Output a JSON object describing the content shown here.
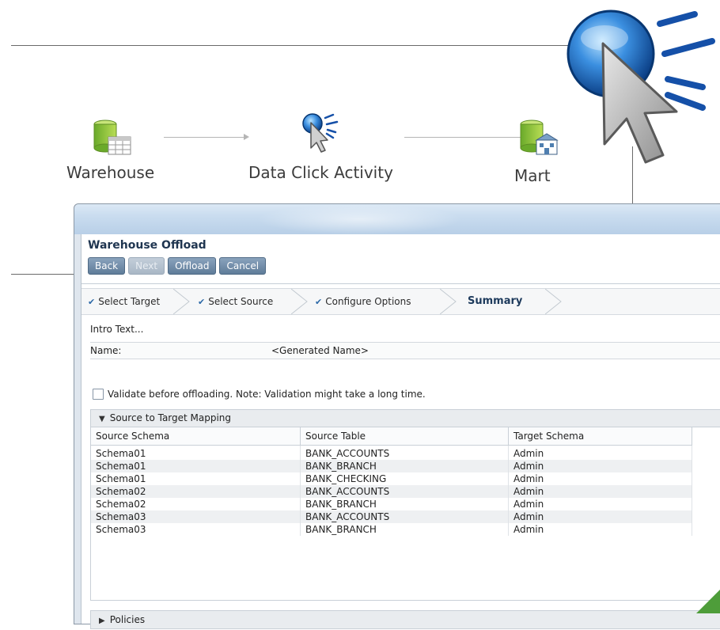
{
  "flow": {
    "nodes": [
      {
        "label": "Warehouse",
        "icon": "database-table-icon"
      },
      {
        "label": "Data Click Activity",
        "icon": "data-click-cursor-icon"
      },
      {
        "label": "Mart",
        "icon": "database-mart-icon"
      }
    ]
  },
  "window": {
    "title": "Warehouse Offload",
    "toolbar": {
      "back": "Back",
      "next": "Next",
      "offload": "Offload",
      "cancel": "Cancel"
    },
    "steps": [
      {
        "label": "Select Target",
        "done": true
      },
      {
        "label": "Select Source",
        "done": true
      },
      {
        "label": "Configure Options",
        "done": true
      },
      {
        "label": "Summary",
        "done": false,
        "active": true
      }
    ],
    "intro": "Intro Text...",
    "name_label": "Name:",
    "name_value": "<Generated Name>",
    "validate_label": "Validate before offloading. Note: Validation might take a long time.",
    "mapping": {
      "title": "Source to Target Mapping",
      "columns": [
        "Source Schema",
        "Source Table",
        "Target Schema"
      ],
      "rows": [
        [
          "Schema01",
          "BANK_ACCOUNTS",
          "Admin"
        ],
        [
          "Schema01",
          "BANK_BRANCH",
          "Admin"
        ],
        [
          "Schema01",
          "BANK_CHECKING",
          "Admin"
        ],
        [
          "Schema02",
          "BANK_ACCOUNTS",
          "Admin"
        ],
        [
          "Schema02",
          "BANK_BRANCH",
          "Admin"
        ],
        [
          "Schema03",
          "BANK_ACCOUNTS",
          "Admin"
        ],
        [
          "Schema03",
          "BANK_BRANCH",
          "Admin"
        ]
      ]
    },
    "policies_title": "Policies"
  },
  "colors": {
    "accent": "#2e6aa8",
    "button": "#6f8bab",
    "titlebar": "#c9dcef"
  }
}
